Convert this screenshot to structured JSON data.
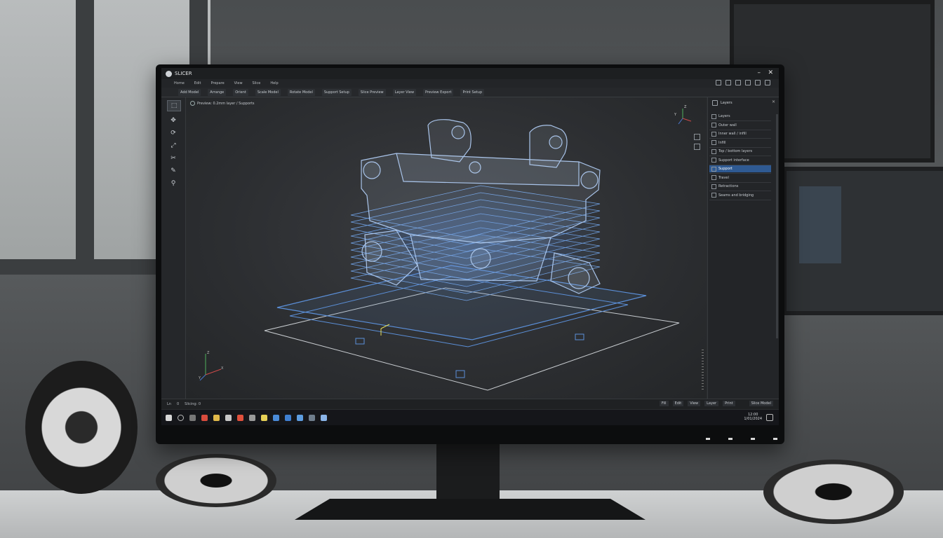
{
  "app": {
    "title": "SLICER",
    "window_controls": {
      "minimize": "–",
      "close": "✕"
    }
  },
  "menu": {
    "items": [
      "Home",
      "Edit",
      "Prepare",
      "View",
      "Slice",
      "Help"
    ]
  },
  "toolbar": {
    "buttons": [
      "Add Model",
      "Arrange",
      "Orient",
      "Scale Model",
      "Rotate Model",
      "Support Setup",
      "Slice Preview",
      "Layer View",
      "Preview Export",
      "Print Setup"
    ]
  },
  "viewport": {
    "label": "Preview: 0.2mm layer / Supports",
    "axis": {
      "x": "X",
      "y": "Y",
      "z": "Z"
    },
    "gizmo": {
      "z": "Z",
      "y": "Y"
    }
  },
  "right_panel": {
    "title": "Layers",
    "close": "✕",
    "items": [
      {
        "label": "Layers",
        "selected": false
      },
      {
        "label": "Outer wall",
        "selected": false
      },
      {
        "label": "Inner wall / infill",
        "selected": false
      },
      {
        "label": "Infill",
        "selected": false
      },
      {
        "label": "Top / bottom layers",
        "selected": false
      },
      {
        "label": "Support interface",
        "selected": false
      },
      {
        "label": "Support",
        "selected": true
      },
      {
        "label": "Travel",
        "selected": false
      },
      {
        "label": "Retractions",
        "selected": false
      },
      {
        "label": "Seams and bridging",
        "selected": false
      }
    ]
  },
  "statusbar": {
    "left": [
      "Ln",
      "0",
      "Slicing: 0"
    ],
    "right": [
      "Fill",
      "Edit",
      "View",
      "Layer",
      "Print"
    ],
    "slice_button": "Slice Model"
  },
  "taskbar": {
    "clock_time": "12:00",
    "clock_date": "1/01/2024"
  },
  "colors": {
    "accent": "#2f5a92",
    "wireframe": "#8fb8ef",
    "layer": "#5b8fd8"
  }
}
